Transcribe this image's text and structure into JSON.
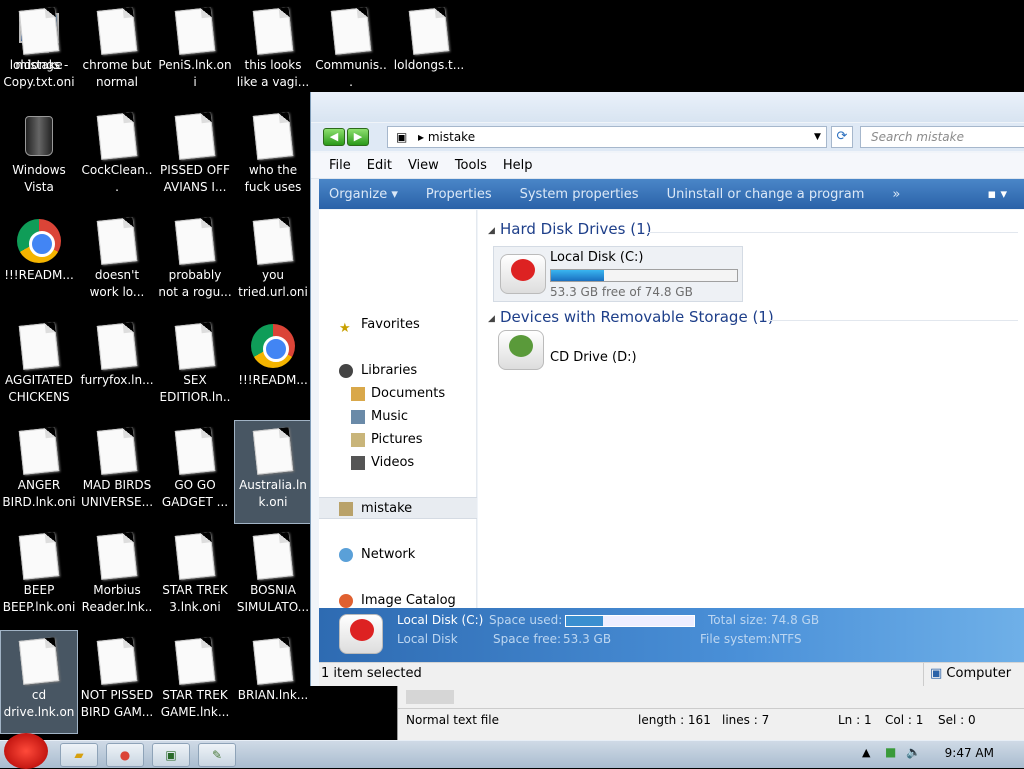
{
  "desktop": {
    "icons": [
      {
        "label": "mistake",
        "kind": "monitor"
      },
      {
        "label": "chrome but normal col...",
        "kind": "doc"
      },
      {
        "label": "PeniS.lnk.oni",
        "kind": "doc"
      },
      {
        "label": "this looks like a vagi...",
        "kind": "doc"
      },
      {
        "label": "Communis...",
        "kind": "doc"
      },
      {
        "label": "loldongs.t...",
        "kind": "doc"
      },
      {
        "label": "Windows Vista",
        "kind": "bin"
      },
      {
        "label": "CockClean...",
        "kind": "doc"
      },
      {
        "label": "PISSED OFF AVIANS I...",
        "kind": "doc"
      },
      {
        "label": "who the fuck uses this.ln...",
        "kind": "doc"
      },
      {
        "label": "!!!READM...",
        "kind": "chrome"
      },
      {
        "label": "doesn't work lo...",
        "kind": "doc"
      },
      {
        "label": "probably not a rogu...",
        "kind": "doc"
      },
      {
        "label": "you tried.url.oni",
        "kind": "doc"
      },
      {
        "label": "AGGITATED CHICKENS ...",
        "kind": "doc"
      },
      {
        "label": "furryfox.ln...",
        "kind": "doc"
      },
      {
        "label": "SEX EDITIOR.ln...",
        "kind": "doc"
      },
      {
        "label": "!!!READM...",
        "kind": "chrome"
      },
      {
        "label": "ANGER BIRD.lnk.oni",
        "kind": "doc"
      },
      {
        "label": "MAD BIRDS UNIVERSE...",
        "kind": "doc"
      },
      {
        "label": "GO GO GADGET ...",
        "kind": "doc"
      },
      {
        "label": "Australia.lnk.oni",
        "kind": "doc",
        "selected": true
      },
      {
        "label": "BEEP BEEP.lnk.oni",
        "kind": "doc"
      },
      {
        "label": "Morbius Reader.lnk...",
        "kind": "doc"
      },
      {
        "label": "STAR TREK 3.lnk.oni",
        "kind": "doc"
      },
      {
        "label": "BOSNIA SIMULATO...",
        "kind": "doc"
      },
      {
        "label": "cd drive.lnk.oni",
        "kind": "doc",
        "selected": true
      },
      {
        "label": "NOT PISSED BIRD GAM...",
        "kind": "doc"
      },
      {
        "label": "STAR TREK GAME.lnk...",
        "kind": "doc"
      },
      {
        "label": "BRIAN.lnk...",
        "kind": "doc"
      },
      {
        "label": "loldongs - Copy.txt.oni",
        "kind": "doc"
      }
    ]
  },
  "explorer": {
    "address": "mistake",
    "search_placeholder": "Search mistake",
    "menu": [
      "File",
      "Edit",
      "View",
      "Tools",
      "Help"
    ],
    "commands": [
      "Organize ▾",
      "Properties",
      "System properties",
      "Uninstall or change a program",
      "»"
    ],
    "nav": {
      "favorites": "Favorites",
      "libraries": "Libraries",
      "documents": "Documents",
      "music": "Music",
      "pictures": "Pictures",
      "videos": "Videos",
      "computer": "mistake",
      "network": "Network",
      "image_catalog": "Image Catalog"
    },
    "groups": {
      "hdd": "Hard Disk Drives (1)",
      "removable": "Devices with Removable Storage (1)"
    },
    "drive_c": {
      "name": "Local Disk (C:)",
      "free_text": "53.3 GB free of 74.8 GB",
      "used_fraction": 0.287
    },
    "drive_d": {
      "name": "CD Drive (D:)"
    },
    "details": {
      "name": "Local Disk (C:)",
      "type": "Local Disk",
      "space_used_label": "Space used:",
      "space_free_label": "Space free:",
      "space_free_value": "53.3 GB",
      "total_size_label": "Total size:",
      "total_size_value": "74.8 GB",
      "fs_label": "File system:",
      "fs_value": "NTFS"
    },
    "status": {
      "selected": "1 item selected",
      "location": "Computer"
    }
  },
  "notepad": {
    "type": "Normal text file",
    "length": "length : 161",
    "lines": "lines : 7",
    "ln": "Ln : 1",
    "col": "Col : 1",
    "sel": "Sel : 0"
  },
  "taskbar": {
    "clock": "9:47 AM"
  }
}
